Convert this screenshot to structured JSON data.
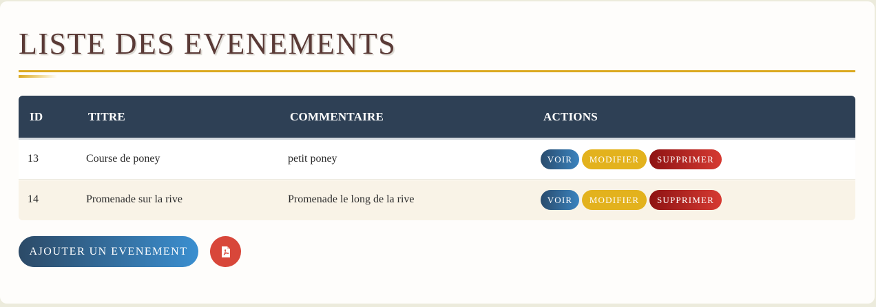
{
  "page": {
    "title": "LISTE DES EVENEMENTS"
  },
  "table": {
    "headers": [
      "ID",
      "TITRE",
      "COMMENTAIRE",
      "ACTIONS"
    ],
    "rows": [
      {
        "id": "13",
        "titre": "Course de poney",
        "commentaire": "petit poney",
        "actions": {
          "view": "VOIR",
          "edit": "MODIFIER",
          "delete": "SUPPRIMER"
        }
      },
      {
        "id": "14",
        "titre": "Promenade sur la rive",
        "commentaire": "Promenade le long de la rive",
        "actions": {
          "view": "VOIR",
          "edit": "MODIFIER",
          "delete": "SUPPRIMER"
        }
      }
    ]
  },
  "footer": {
    "add_label": "AJOUTER UN EVENEMENT",
    "pdf_icon": "file-pdf-icon"
  },
  "colors": {
    "title": "#5a3a36",
    "accent_gold": "#dba91f",
    "header_bg": "#2e4055",
    "view_button": "#3a83bf",
    "edit_button": "#e3b21d",
    "delete_button": "#c12a25",
    "pdf_button": "#d8473a"
  }
}
